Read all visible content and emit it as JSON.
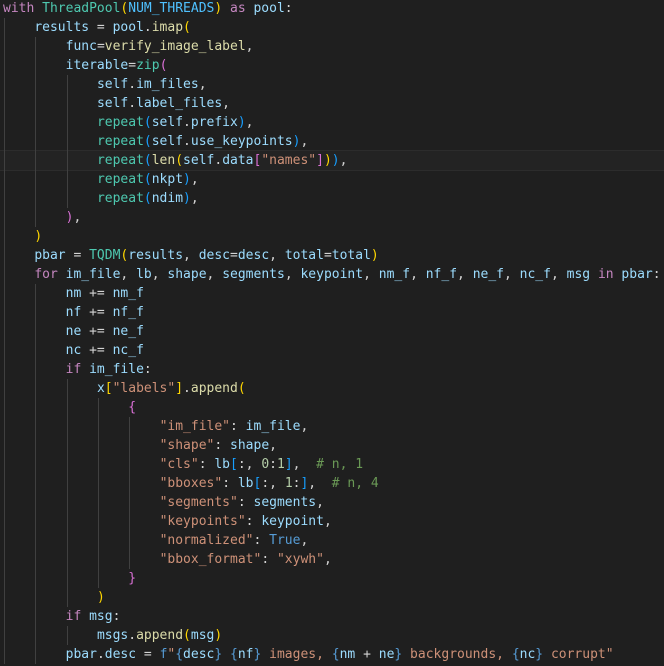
{
  "editor": {
    "language": "python",
    "theme_colors": {
      "background": "#1f1f1f",
      "keyword_control": "#c586c0",
      "keyword": "#569cd6",
      "function": "#dcdcaa",
      "variable": "#9cdcfe",
      "class": "#4ec9b0",
      "constant": "#4fc1ff",
      "string": "#ce9178",
      "number": "#b5cea8",
      "comment": "#6a9955",
      "bracket_1": "#ffd700",
      "bracket_2": "#da70d6",
      "bracket_3": "#179fff"
    },
    "current_line_index": 8,
    "lines": [
      {
        "indent": 0,
        "tokens": [
          [
            "kw",
            "with"
          ],
          [
            "op",
            " "
          ],
          [
            "cls",
            "ThreadPool"
          ],
          [
            "p1",
            "("
          ],
          [
            "const",
            "NUM_THREADS"
          ],
          [
            "p1",
            ")"
          ],
          [
            "op",
            " "
          ],
          [
            "kw",
            "as"
          ],
          [
            "op",
            " "
          ],
          [
            "var",
            "pool"
          ],
          [
            "op",
            ":"
          ]
        ]
      },
      {
        "indent": 1,
        "tokens": [
          [
            "var",
            "results"
          ],
          [
            "op",
            " = "
          ],
          [
            "var",
            "pool"
          ],
          [
            "op",
            "."
          ],
          [
            "fn",
            "imap"
          ],
          [
            "p1",
            "("
          ]
        ]
      },
      {
        "indent": 2,
        "tokens": [
          [
            "var",
            "func"
          ],
          [
            "op",
            "="
          ],
          [
            "fn",
            "verify_image_label"
          ],
          [
            "op",
            ","
          ]
        ]
      },
      {
        "indent": 2,
        "tokens": [
          [
            "var",
            "iterable"
          ],
          [
            "op",
            "="
          ],
          [
            "cls",
            "zip"
          ],
          [
            "p2",
            "("
          ]
        ]
      },
      {
        "indent": 3,
        "tokens": [
          [
            "var",
            "self"
          ],
          [
            "op",
            "."
          ],
          [
            "var",
            "im_files"
          ],
          [
            "op",
            ","
          ]
        ]
      },
      {
        "indent": 3,
        "tokens": [
          [
            "var",
            "self"
          ],
          [
            "op",
            "."
          ],
          [
            "var",
            "label_files"
          ],
          [
            "op",
            ","
          ]
        ]
      },
      {
        "indent": 3,
        "tokens": [
          [
            "cls",
            "repeat"
          ],
          [
            "p3",
            "("
          ],
          [
            "var",
            "self"
          ],
          [
            "op",
            "."
          ],
          [
            "var",
            "prefix"
          ],
          [
            "p3",
            ")"
          ],
          [
            "op",
            ","
          ]
        ]
      },
      {
        "indent": 3,
        "tokens": [
          [
            "cls",
            "repeat"
          ],
          [
            "p3",
            "("
          ],
          [
            "var",
            "self"
          ],
          [
            "op",
            "."
          ],
          [
            "var",
            "use_keypoints"
          ],
          [
            "p3",
            ")"
          ],
          [
            "op",
            ","
          ]
        ]
      },
      {
        "indent": 3,
        "tokens": [
          [
            "cls",
            "repeat"
          ],
          [
            "p3",
            "("
          ],
          [
            "fn",
            "len"
          ],
          [
            "p1",
            "("
          ],
          [
            "var",
            "self"
          ],
          [
            "op",
            "."
          ],
          [
            "var",
            "data"
          ],
          [
            "p2",
            "["
          ],
          [
            "str",
            "\"names\""
          ],
          [
            "p2",
            "]"
          ],
          [
            "p1",
            ")"
          ],
          [
            "p3",
            ")"
          ],
          [
            "op",
            ","
          ]
        ]
      },
      {
        "indent": 3,
        "tokens": [
          [
            "cls",
            "repeat"
          ],
          [
            "p3",
            "("
          ],
          [
            "var",
            "nkpt"
          ],
          [
            "p3",
            ")"
          ],
          [
            "op",
            ","
          ]
        ]
      },
      {
        "indent": 3,
        "tokens": [
          [
            "cls",
            "repeat"
          ],
          [
            "p3",
            "("
          ],
          [
            "var",
            "ndim"
          ],
          [
            "p3",
            ")"
          ],
          [
            "op",
            ","
          ]
        ]
      },
      {
        "indent": 2,
        "tokens": [
          [
            "p2",
            ")"
          ],
          [
            "op",
            ","
          ]
        ]
      },
      {
        "indent": 1,
        "tokens": [
          [
            "p1",
            ")"
          ]
        ]
      },
      {
        "indent": 1,
        "tokens": [
          [
            "var",
            "pbar"
          ],
          [
            "op",
            " = "
          ],
          [
            "cls",
            "TQDM"
          ],
          [
            "p1",
            "("
          ],
          [
            "var",
            "results"
          ],
          [
            "op",
            ", "
          ],
          [
            "var",
            "desc"
          ],
          [
            "op",
            "="
          ],
          [
            "var",
            "desc"
          ],
          [
            "op",
            ", "
          ],
          [
            "var",
            "total"
          ],
          [
            "op",
            "="
          ],
          [
            "var",
            "total"
          ],
          [
            "p1",
            ")"
          ]
        ]
      },
      {
        "indent": 1,
        "tokens": [
          [
            "kw",
            "for"
          ],
          [
            "op",
            " "
          ],
          [
            "var",
            "im_file"
          ],
          [
            "op",
            ", "
          ],
          [
            "var",
            "lb"
          ],
          [
            "op",
            ", "
          ],
          [
            "var",
            "shape"
          ],
          [
            "op",
            ", "
          ],
          [
            "var",
            "segments"
          ],
          [
            "op",
            ", "
          ],
          [
            "var",
            "keypoint"
          ],
          [
            "op",
            ", "
          ],
          [
            "var",
            "nm_f"
          ],
          [
            "op",
            ", "
          ],
          [
            "var",
            "nf_f"
          ],
          [
            "op",
            ", "
          ],
          [
            "var",
            "ne_f"
          ],
          [
            "op",
            ", "
          ],
          [
            "var",
            "nc_f"
          ],
          [
            "op",
            ", "
          ],
          [
            "var",
            "msg"
          ],
          [
            "op",
            " "
          ],
          [
            "kw",
            "in"
          ],
          [
            "op",
            " "
          ],
          [
            "var",
            "pbar"
          ],
          [
            "op",
            ":"
          ]
        ]
      },
      {
        "indent": 2,
        "tokens": [
          [
            "var",
            "nm"
          ],
          [
            "op",
            " += "
          ],
          [
            "var",
            "nm_f"
          ]
        ]
      },
      {
        "indent": 2,
        "tokens": [
          [
            "var",
            "nf"
          ],
          [
            "op",
            " += "
          ],
          [
            "var",
            "nf_f"
          ]
        ]
      },
      {
        "indent": 2,
        "tokens": [
          [
            "var",
            "ne"
          ],
          [
            "op",
            " += "
          ],
          [
            "var",
            "ne_f"
          ]
        ]
      },
      {
        "indent": 2,
        "tokens": [
          [
            "var",
            "nc"
          ],
          [
            "op",
            " += "
          ],
          [
            "var",
            "nc_f"
          ]
        ]
      },
      {
        "indent": 2,
        "tokens": [
          [
            "kw",
            "if"
          ],
          [
            "op",
            " "
          ],
          [
            "var",
            "im_file"
          ],
          [
            "op",
            ":"
          ]
        ]
      },
      {
        "indent": 3,
        "tokens": [
          [
            "var",
            "x"
          ],
          [
            "p1",
            "["
          ],
          [
            "str",
            "\"labels\""
          ],
          [
            "p1",
            "]"
          ],
          [
            "op",
            "."
          ],
          [
            "fn",
            "append"
          ],
          [
            "p1",
            "("
          ]
        ]
      },
      {
        "indent": 4,
        "tokens": [
          [
            "p2",
            "{"
          ]
        ]
      },
      {
        "indent": 5,
        "tokens": [
          [
            "str",
            "\"im_file\""
          ],
          [
            "op",
            ": "
          ],
          [
            "var",
            "im_file"
          ],
          [
            "op",
            ","
          ]
        ]
      },
      {
        "indent": 5,
        "tokens": [
          [
            "str",
            "\"shape\""
          ],
          [
            "op",
            ": "
          ],
          [
            "var",
            "shape"
          ],
          [
            "op",
            ","
          ]
        ]
      },
      {
        "indent": 5,
        "tokens": [
          [
            "str",
            "\"cls\""
          ],
          [
            "op",
            ": "
          ],
          [
            "var",
            "lb"
          ],
          [
            "p3",
            "["
          ],
          [
            "op",
            ":, "
          ],
          [
            "num",
            "0"
          ],
          [
            "op",
            ":"
          ],
          [
            "num",
            "1"
          ],
          [
            "p3",
            "]"
          ],
          [
            "op",
            ",  "
          ],
          [
            "com",
            "# n, 1"
          ]
        ]
      },
      {
        "indent": 5,
        "tokens": [
          [
            "str",
            "\"bboxes\""
          ],
          [
            "op",
            ": "
          ],
          [
            "var",
            "lb"
          ],
          [
            "p3",
            "["
          ],
          [
            "op",
            ":, "
          ],
          [
            "num",
            "1"
          ],
          [
            "op",
            ":"
          ],
          [
            "p3",
            "]"
          ],
          [
            "op",
            ",  "
          ],
          [
            "com",
            "# n, 4"
          ]
        ]
      },
      {
        "indent": 5,
        "tokens": [
          [
            "str",
            "\"segments\""
          ],
          [
            "op",
            ": "
          ],
          [
            "var",
            "segments"
          ],
          [
            "op",
            ","
          ]
        ]
      },
      {
        "indent": 5,
        "tokens": [
          [
            "str",
            "\"keypoints\""
          ],
          [
            "op",
            ": "
          ],
          [
            "var",
            "keypoint"
          ],
          [
            "op",
            ","
          ]
        ]
      },
      {
        "indent": 5,
        "tokens": [
          [
            "str",
            "\"normalized\""
          ],
          [
            "op",
            ": "
          ],
          [
            "kwb",
            "True"
          ],
          [
            "op",
            ","
          ]
        ]
      },
      {
        "indent": 5,
        "tokens": [
          [
            "str",
            "\"bbox_format\""
          ],
          [
            "op",
            ": "
          ],
          [
            "str",
            "\"xywh\""
          ],
          [
            "op",
            ","
          ]
        ]
      },
      {
        "indent": 4,
        "tokens": [
          [
            "p2",
            "}"
          ]
        ]
      },
      {
        "indent": 3,
        "tokens": [
          [
            "p1",
            ")"
          ]
        ]
      },
      {
        "indent": 2,
        "tokens": [
          [
            "kw",
            "if"
          ],
          [
            "op",
            " "
          ],
          [
            "var",
            "msg"
          ],
          [
            "op",
            ":"
          ]
        ]
      },
      {
        "indent": 3,
        "tokens": [
          [
            "var",
            "msgs"
          ],
          [
            "op",
            "."
          ],
          [
            "fn",
            "append"
          ],
          [
            "p1",
            "("
          ],
          [
            "var",
            "msg"
          ],
          [
            "p1",
            ")"
          ]
        ]
      },
      {
        "indent": 2,
        "tokens": [
          [
            "var",
            "pbar"
          ],
          [
            "op",
            "."
          ],
          [
            "var",
            "desc"
          ],
          [
            "op",
            " = "
          ],
          [
            "kwb",
            "f"
          ],
          [
            "str",
            "\""
          ],
          [
            "kwb",
            "{"
          ],
          [
            "var",
            "desc"
          ],
          [
            "kwb",
            "}"
          ],
          [
            "str",
            " "
          ],
          [
            "kwb",
            "{"
          ],
          [
            "var",
            "nf"
          ],
          [
            "kwb",
            "}"
          ],
          [
            "str",
            " images, "
          ],
          [
            "kwb",
            "{"
          ],
          [
            "var",
            "nm"
          ],
          [
            "op",
            " + "
          ],
          [
            "var",
            "ne"
          ],
          [
            "kwb",
            "}"
          ],
          [
            "str",
            " backgrounds, "
          ],
          [
            "kwb",
            "{"
          ],
          [
            "var",
            "nc"
          ],
          [
            "kwb",
            "}"
          ],
          [
            "str",
            " corrupt\""
          ]
        ]
      }
    ]
  }
}
